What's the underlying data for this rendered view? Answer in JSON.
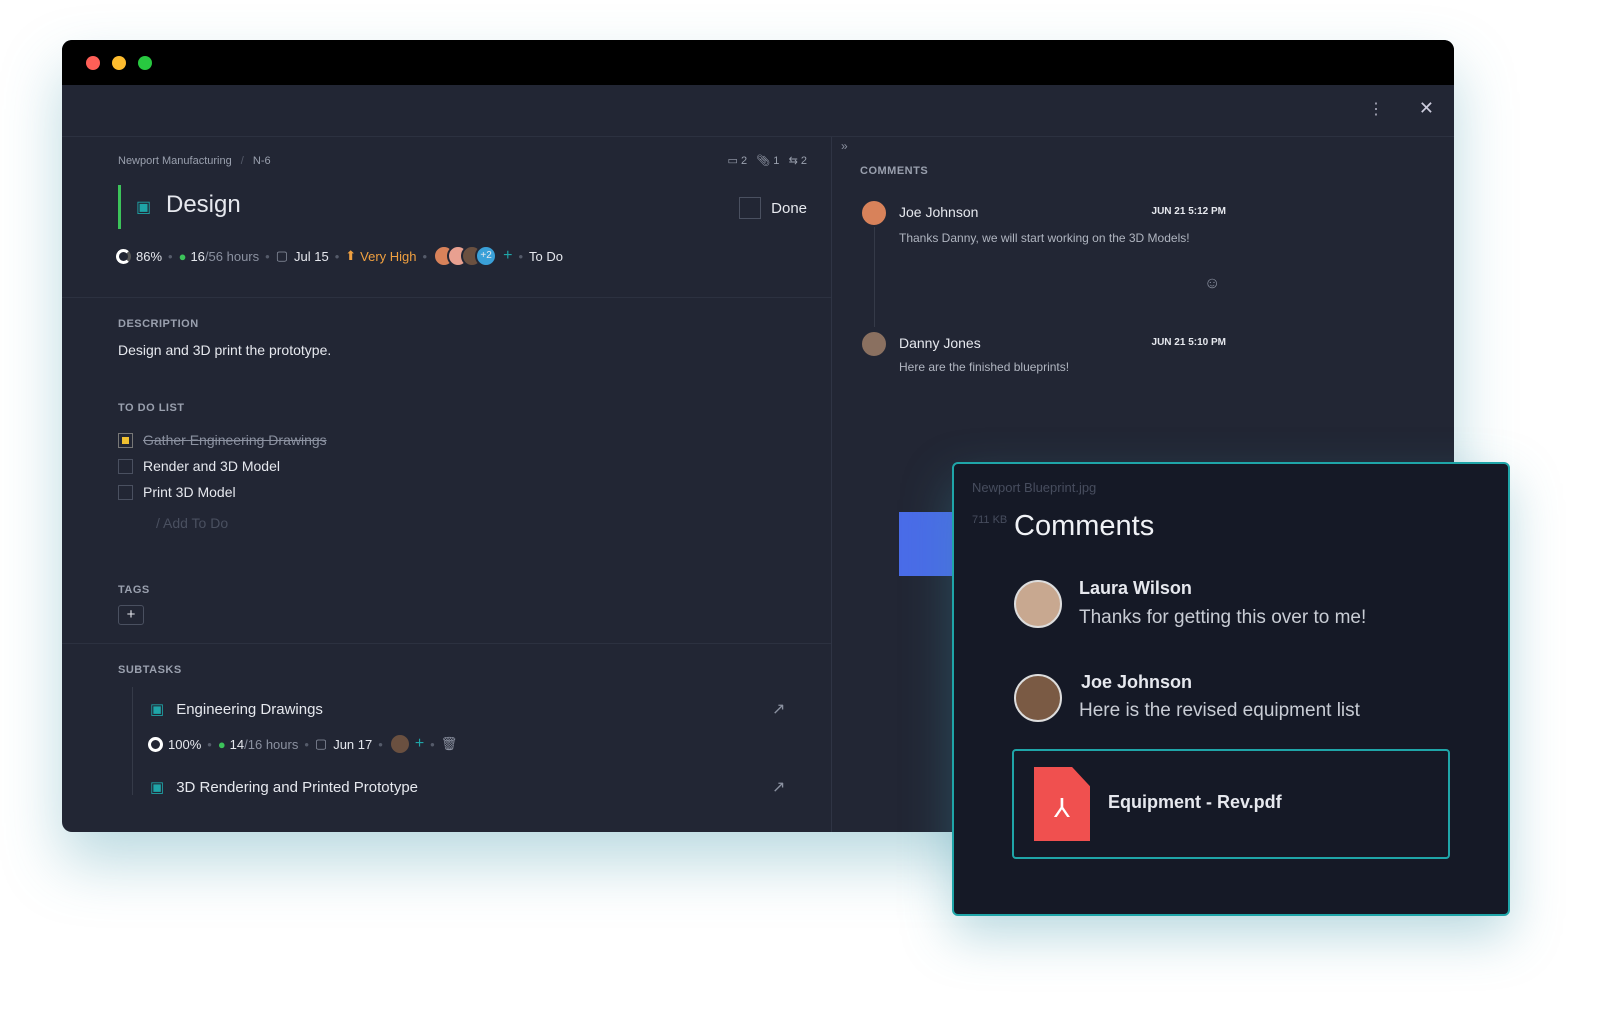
{
  "breadcrumb": {
    "project": "Newport Manufacturing",
    "sep": "/",
    "id": "N-6"
  },
  "counts": {
    "comments": "2",
    "attachments": "1",
    "subtasks": "2"
  },
  "task": {
    "title": "Design",
    "done_label": "Done",
    "progress": "86%",
    "hours_done": "16",
    "hours_total": "/56 hours",
    "date": "Jul 15",
    "priority": "Very High",
    "extra_assignees": "+2",
    "status": "To Do"
  },
  "description": {
    "label": "DESCRIPTION",
    "text": "Design and 3D print the prototype."
  },
  "todo": {
    "label": "TO DO LIST",
    "items": [
      {
        "text": "Gather Engineering Drawings",
        "done": true
      },
      {
        "text": "Render and 3D Model",
        "done": false
      },
      {
        "text": "Print 3D Model",
        "done": false
      }
    ],
    "add_placeholder": "/ Add To Do"
  },
  "tags": {
    "label": "TAGS",
    "add": "+"
  },
  "subtasks": {
    "label": "SUBTASKS",
    "items": [
      {
        "title": "Engineering Drawings",
        "progress": "100%",
        "hours_done": "14",
        "hours_total": "/16 hours",
        "date": "Jun 17"
      },
      {
        "title": "3D Rendering and Printed Prototype"
      }
    ]
  },
  "comments_panel": {
    "collapse": "»",
    "label": "COMMENTS",
    "items": [
      {
        "author": "Joe Johnson",
        "time": "JUN 21 5:12 PM",
        "text": "Thanks Danny, we will start working on the 3D Models!"
      },
      {
        "author": "Danny Jones",
        "time": "JUN 21 5:10 PM",
        "text": "Here are the finished blueprints!"
      }
    ],
    "attachment": {
      "name": "Newport Blueprint.jpg",
      "size": "711 KB"
    }
  },
  "popup": {
    "title": "Comments",
    "items": [
      {
        "author": "Laura Wilson",
        "text": "Thanks for getting this over to me!"
      },
      {
        "author": "Joe Johnson",
        "text": "Here is the revised equipment list"
      }
    ],
    "file": "Equipment - Rev.pdf"
  },
  "colors": {
    "accent": "#1fa5a8",
    "priority": "#f0a040",
    "green": "#3cc35a",
    "pdf": "#f0504f"
  }
}
